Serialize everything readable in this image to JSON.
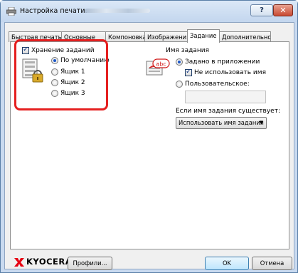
{
  "window": {
    "title": "Настройка печати:",
    "help_glyph": "?",
    "close_glyph": "✕"
  },
  "tabs": [
    {
      "label": "Быстрая печать",
      "active": false
    },
    {
      "label": "Основные",
      "active": false
    },
    {
      "label": "Компоновка",
      "active": false
    },
    {
      "label": "Изображения",
      "active": false
    },
    {
      "label": "Задание",
      "active": true
    },
    {
      "label": "Дополнительно",
      "active": false
    }
  ],
  "job_storage": {
    "checkbox_label": "Хранение заданий",
    "checked": true,
    "options": [
      {
        "label": "По умолчанию",
        "selected": true
      },
      {
        "label": "Ящик 1",
        "selected": false
      },
      {
        "label": "Ящик 2",
        "selected": false
      },
      {
        "label": "Ящик 3",
        "selected": false
      }
    ]
  },
  "job_name": {
    "heading": "Имя задания",
    "icon_text": "abc",
    "app_defined_label": "Задано в приложении",
    "app_defined_selected": true,
    "no_name_label": "Не использовать имя",
    "no_name_checked": true,
    "custom_label": "Пользовательское:",
    "custom_selected": false,
    "custom_value": "",
    "if_exists_label": "Если имя задания существует:",
    "if_exists_value": "Использовать имя задания"
  },
  "footer": {
    "brand": "KYOCERA",
    "profiles_button": "Профили...",
    "ok_button": "OK",
    "cancel_button": "Отмена"
  },
  "colors": {
    "highlight": "#e52020",
    "brand_red": "#e60012",
    "selected_radio": "#1a56c8"
  }
}
